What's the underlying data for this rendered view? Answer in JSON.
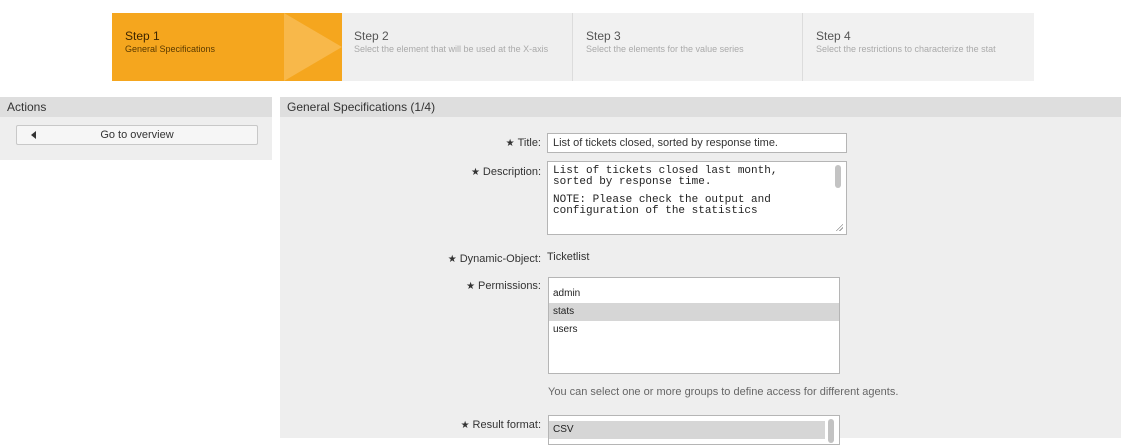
{
  "steps": [
    {
      "title": "Step 1",
      "desc": "General Specifications"
    },
    {
      "title": "Step 2",
      "desc": "Select the element that will be used at the X-axis"
    },
    {
      "title": "Step 3",
      "desc": "Select the elements for the value series"
    },
    {
      "title": "Step 4",
      "desc": "Select the restrictions to characterize the stat"
    }
  ],
  "sidebar": {
    "title": "Actions",
    "overview_button": "Go to overview"
  },
  "main": {
    "title": "General Specifications (1/4)",
    "title_label": "Title:",
    "title_value": "List of tickets closed, sorted by response time.",
    "description_label": "Description:",
    "description_lines": [
      "List of tickets closed last month,",
      "sorted by response time.",
      "NOTE: Please check the output and",
      "configuration of the statistics"
    ],
    "dynamic_object_label": "Dynamic-Object:",
    "dynamic_object_value": "Ticketlist",
    "permissions_label": "Permissions:",
    "permissions_options": [
      {
        "label": "admin",
        "selected": false
      },
      {
        "label": "stats",
        "selected": true
      },
      {
        "label": "users",
        "selected": false
      }
    ],
    "permissions_hint": "You can select one or more groups to define access for different agents.",
    "result_format_label": "Result format:",
    "result_format_options": [
      {
        "label": "CSV",
        "selected": true
      }
    ],
    "required_marker": "★"
  },
  "colors": {
    "active_step": "#f5a61e",
    "inactive_step": "#f1f1f1",
    "header_bar": "#dedede",
    "panel_bg": "#eeeeee"
  }
}
